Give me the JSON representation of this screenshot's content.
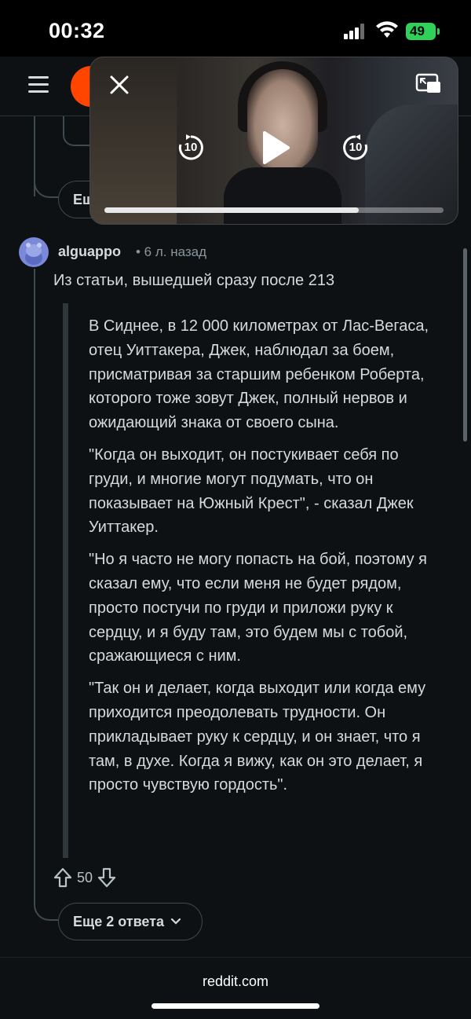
{
  "status_bar": {
    "time": "00:32",
    "battery": "49"
  },
  "video": {
    "progress": 0.75,
    "rewind_label": "10",
    "forward_label": "10"
  },
  "thread": {
    "prev_more_label": "Еще",
    "comment": {
      "username": "alguappo",
      "meta": "• 6 л. назад",
      "lead": "Из статьи, вышедшей сразу после 213",
      "quote": [
        "В Сиднее, в 12 000 километрах от Лас-Вегаса, отец Уиттакера, Джек, наблюдал за боем, присматривая за старшим ребенком Роберта, которого тоже зовут Джек, полный нервов и ожидающий знака от своего сына.",
        "\"Когда он выходит, он постукивает себя по груди, и многие могут подумать, что он показывает на Южный Крест\", - сказал Джек Уиттакер.",
        "\"Но я часто не могу попасть на бой, поэтому я сказал ему, что если меня не будет рядом, просто постучи по груди и приложи руку к сердцу, и я буду там, это будем мы с тобой, сражающиеся с ним.",
        "\"Так он и делает, когда выходит или когда ему приходится преодолевать трудности. Он прикладывает руку к сердцу, и он знает, что я там, в духе. Когда я вижу, как он это делает, я просто чувствую гордость\"."
      ],
      "votes": "50"
    },
    "more_replies_label": "Еще 2 ответа"
  },
  "footer": {
    "url": "reddit.com"
  },
  "colors": {
    "background": "#0e1113",
    "battery": "#2fd158",
    "brand": "#ff4500"
  }
}
